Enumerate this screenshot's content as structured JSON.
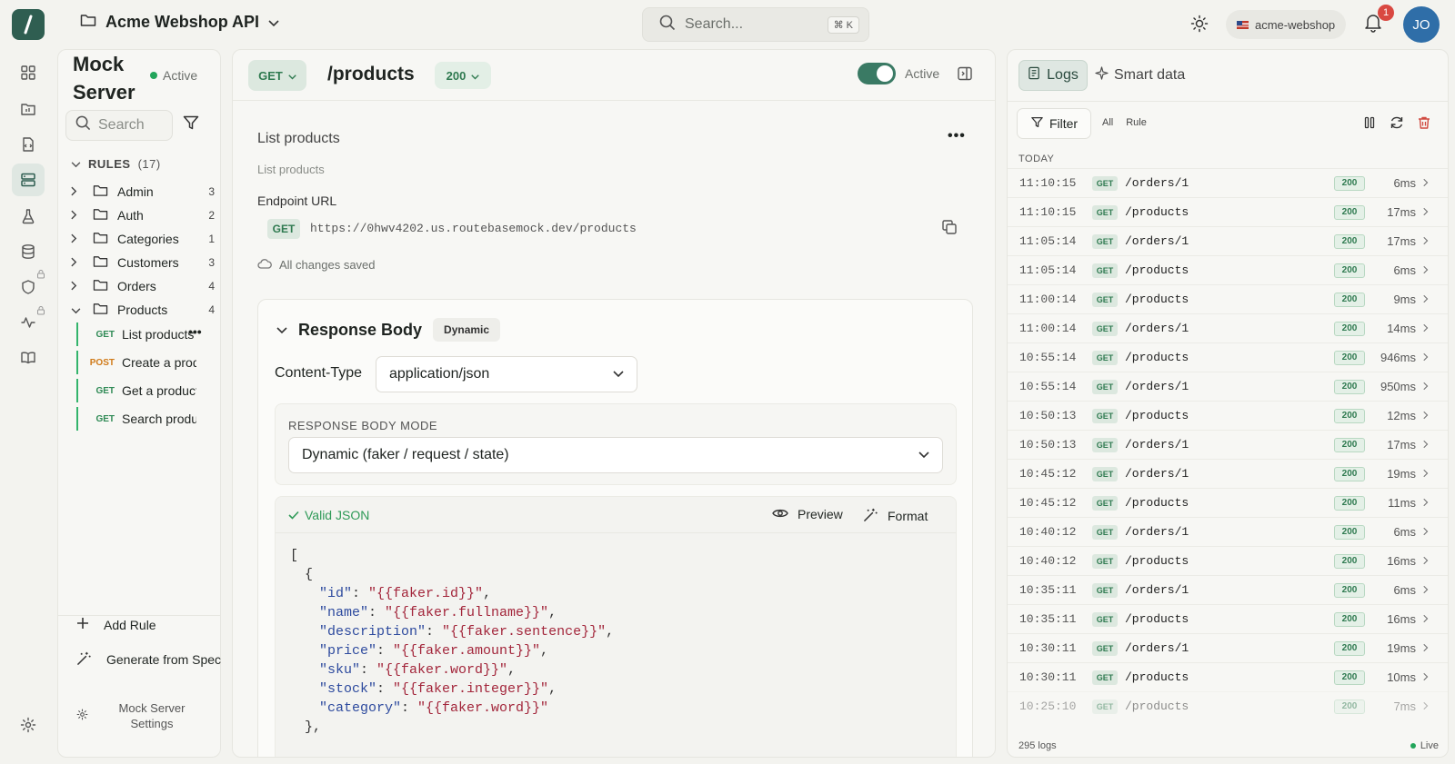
{
  "header": {
    "project_name": "Acme Webshop API",
    "search_placeholder": "Search...",
    "search_shortcut": "⌘ K",
    "workspace": "acme-webshop",
    "notification_count": "1",
    "user_initials": "JO"
  },
  "rules_panel": {
    "title": "Mock Server",
    "status": "Active",
    "search_placeholder": "Search",
    "rules_label": "RULES",
    "rules_count": "(17)",
    "folders": [
      {
        "name": "Admin",
        "count": "3"
      },
      {
        "name": "Auth",
        "count": "2"
      },
      {
        "name": "Categories",
        "count": "1"
      },
      {
        "name": "Customers",
        "count": "3"
      },
      {
        "name": "Orders",
        "count": "4"
      },
      {
        "name": "Products",
        "count": "4"
      }
    ],
    "product_rules": [
      {
        "method": "GET",
        "name": "List products"
      },
      {
        "method": "POST",
        "name": "Create a product"
      },
      {
        "method": "GET",
        "name": "Get a product"
      },
      {
        "method": "GET",
        "name": "Search products"
      }
    ],
    "add_rule": "Add Rule",
    "generate_from_spec": "Generate from Spec",
    "settings": "Mock Server Settings"
  },
  "editor": {
    "method": "GET",
    "path": "/products",
    "status_code": "200",
    "active_label": "Active",
    "rule_name": "List products",
    "rule_description": "List products",
    "endpoint_label": "Endpoint URL",
    "endpoint_method": "GET",
    "endpoint_url": "https://0hwv4202.us.routebasemock.dev/products",
    "saved_status": "All changes saved",
    "response_body_title": "Response Body",
    "response_body_badge": "Dynamic",
    "content_type_label": "Content-Type",
    "content_type_value": "application/json",
    "body_mode_label": "RESPONSE BODY MODE",
    "body_mode_value": "Dynamic (faker / request / state)",
    "valid_json": "Valid JSON",
    "preview": "Preview",
    "format": "Format",
    "code_lines": [
      {
        "indent": 0,
        "text": "["
      },
      {
        "indent": 1,
        "text": "{"
      },
      {
        "indent": 2,
        "key": "\"id\"",
        "value": "\"{{faker.id}}\"",
        "tail": ","
      },
      {
        "indent": 2,
        "key": "\"name\"",
        "value": "\"{{faker.fullname}}\"",
        "tail": ","
      },
      {
        "indent": 2,
        "key": "\"description\"",
        "value": "\"{{faker.sentence}}\"",
        "tail": ","
      },
      {
        "indent": 2,
        "key": "\"price\"",
        "value": "\"{{faker.amount}}\"",
        "tail": ","
      },
      {
        "indent": 2,
        "key": "\"sku\"",
        "value": "\"{{faker.word}}\"",
        "tail": ","
      },
      {
        "indent": 2,
        "key": "\"stock\"",
        "value": "\"{{faker.integer}}\"",
        "tail": ","
      },
      {
        "indent": 2,
        "key": "\"category\"",
        "value": "\"{{faker.word}}\"",
        "tail": ""
      },
      {
        "indent": 1,
        "text": "},"
      }
    ]
  },
  "logs": {
    "tab_logs": "Logs",
    "tab_smart": "Smart data",
    "filter": "Filter",
    "seg_all": "All",
    "seg_rule": "Rule",
    "today_label": "TODAY",
    "entries": [
      {
        "time": "11:10:15",
        "method": "GET",
        "path": "/orders/1",
        "status": "200",
        "duration": "6ms"
      },
      {
        "time": "11:10:15",
        "method": "GET",
        "path": "/products",
        "status": "200",
        "duration": "17ms"
      },
      {
        "time": "11:05:14",
        "method": "GET",
        "path": "/orders/1",
        "status": "200",
        "duration": "17ms"
      },
      {
        "time": "11:05:14",
        "method": "GET",
        "path": "/products",
        "status": "200",
        "duration": "6ms"
      },
      {
        "time": "11:00:14",
        "method": "GET",
        "path": "/products",
        "status": "200",
        "duration": "9ms"
      },
      {
        "time": "11:00:14",
        "method": "GET",
        "path": "/orders/1",
        "status": "200",
        "duration": "14ms"
      },
      {
        "time": "10:55:14",
        "method": "GET",
        "path": "/products",
        "status": "200",
        "duration": "946ms"
      },
      {
        "time": "10:55:14",
        "method": "GET",
        "path": "/orders/1",
        "status": "200",
        "duration": "950ms"
      },
      {
        "time": "10:50:13",
        "method": "GET",
        "path": "/products",
        "status": "200",
        "duration": "12ms"
      },
      {
        "time": "10:50:13",
        "method": "GET",
        "path": "/orders/1",
        "status": "200",
        "duration": "17ms"
      },
      {
        "time": "10:45:12",
        "method": "GET",
        "path": "/orders/1",
        "status": "200",
        "duration": "19ms"
      },
      {
        "time": "10:45:12",
        "method": "GET",
        "path": "/products",
        "status": "200",
        "duration": "11ms"
      },
      {
        "time": "10:40:12",
        "method": "GET",
        "path": "/orders/1",
        "status": "200",
        "duration": "6ms"
      },
      {
        "time": "10:40:12",
        "method": "GET",
        "path": "/products",
        "status": "200",
        "duration": "16ms"
      },
      {
        "time": "10:35:11",
        "method": "GET",
        "path": "/orders/1",
        "status": "200",
        "duration": "6ms"
      },
      {
        "time": "10:35:11",
        "method": "GET",
        "path": "/products",
        "status": "200",
        "duration": "16ms"
      },
      {
        "time": "10:30:11",
        "method": "GET",
        "path": "/orders/1",
        "status": "200",
        "duration": "19ms"
      },
      {
        "time": "10:30:11",
        "method": "GET",
        "path": "/products",
        "status": "200",
        "duration": "10ms"
      },
      {
        "time": "10:25:10",
        "method": "GET",
        "path": "/products",
        "status": "200",
        "duration": "7ms"
      }
    ],
    "total": "295 logs",
    "live": "Live"
  }
}
